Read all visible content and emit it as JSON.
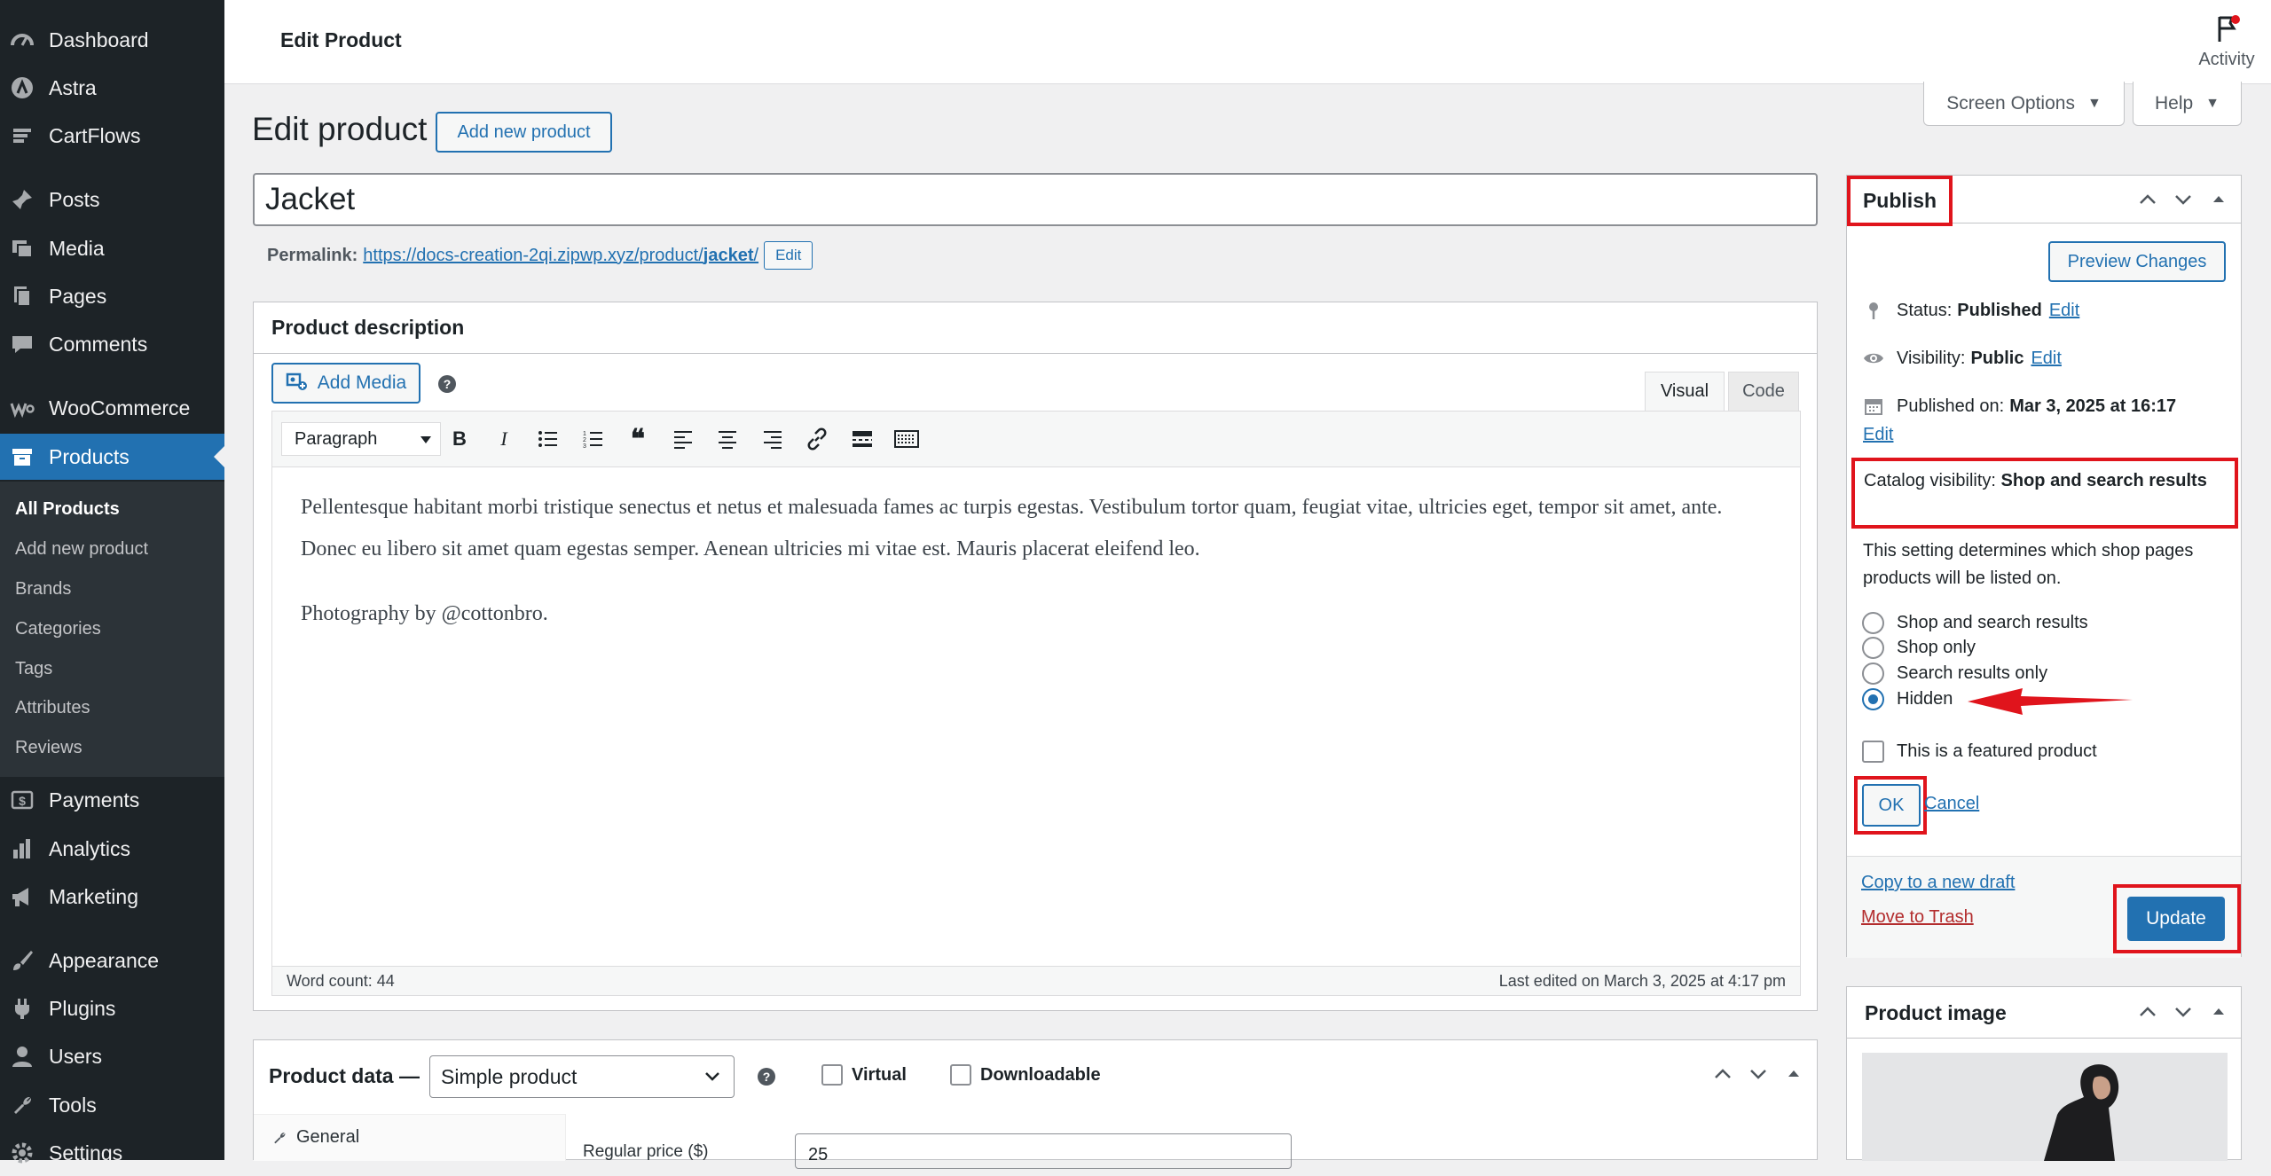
{
  "sidebar": {
    "menu": [
      {
        "label": "Dashboard",
        "icon": "dashboard-icon"
      },
      {
        "label": "Astra",
        "icon": "astra-icon"
      },
      {
        "label": "CartFlows",
        "icon": "cartflows-icon"
      },
      {
        "label": "Posts",
        "icon": "pin-icon"
      },
      {
        "label": "Media",
        "icon": "media-icon"
      },
      {
        "label": "Pages",
        "icon": "pages-icon"
      },
      {
        "label": "Comments",
        "icon": "comment-icon"
      },
      {
        "label": "WooCommerce",
        "icon": "woocommerce-icon"
      },
      {
        "label": "Products",
        "icon": "archive-icon"
      },
      {
        "label": "Payments",
        "icon": "payments-icon"
      },
      {
        "label": "Analytics",
        "icon": "analytics-icon"
      },
      {
        "label": "Marketing",
        "icon": "megaphone-icon"
      },
      {
        "label": "Appearance",
        "icon": "brush-icon"
      },
      {
        "label": "Plugins",
        "icon": "plug-icon"
      },
      {
        "label": "Users",
        "icon": "user-icon"
      },
      {
        "label": "Tools",
        "icon": "wrench-icon"
      },
      {
        "label": "Settings",
        "icon": "settings-icon"
      }
    ],
    "submenu": [
      "All Products",
      "Add new product",
      "Brands",
      "Categories",
      "Tags",
      "Attributes",
      "Reviews"
    ]
  },
  "topbar": {
    "title": "Edit Product",
    "activity_label": "Activity"
  },
  "screen_options_label": "Screen Options",
  "help_label": "Help",
  "heading": {
    "title": "Edit product",
    "add_new_label": "Add new product"
  },
  "product_title": "Jacket",
  "permalink": {
    "label": "Permalink:",
    "url_base": "https://docs-creation-2qi.zipwp.xyz/product/",
    "slug": "jacket",
    "url_end": "/",
    "edit_label": "Edit"
  },
  "description": {
    "header": "Product description",
    "add_media_label": "Add Media",
    "help_glyph": "?",
    "tab_visual": "Visual",
    "tab_code": "Code",
    "format": "Paragraph",
    "paragraphs": [
      "Pellentesque habitant morbi tristique senectus et netus et malesuada fames ac turpis egestas. Vestibulum tortor quam, feugiat vitae, ultricies eget, tempor sit amet, ante. Donec eu libero sit amet quam egestas semper. Aenean ultricies mi vitae est. Mauris placerat eleifend leo.",
      "Photography by @cottonbro."
    ],
    "word_count": "Word count: 44",
    "last_edited": "Last edited on March 3, 2025 at 4:17 pm"
  },
  "product_data": {
    "title": "Product data —",
    "type": "Simple product",
    "help_glyph": "?",
    "virtual_label": "Virtual",
    "downloadable_label": "Downloadable",
    "tab_general": "General",
    "regular_price_label": "Regular price ($)",
    "regular_price_value": "25"
  },
  "publish": {
    "title": "Publish",
    "preview_label": "Preview Changes",
    "status_label": "Status:",
    "status_value": "Published",
    "visibility_label": "Visibility:",
    "visibility_value": "Public",
    "published_label": "Published on:",
    "published_value": "Mar 3, 2025 at 16:17",
    "edit_label": "Edit",
    "catalog_label": "Catalog visibility:",
    "catalog_value": "Shop and search results",
    "catalog_desc": "This setting determines which shop pages products will be listed on.",
    "options": [
      {
        "label": "Shop and search results",
        "checked": false
      },
      {
        "label": "Shop only",
        "checked": false
      },
      {
        "label": "Search results only",
        "checked": false
      },
      {
        "label": "Hidden",
        "checked": true
      }
    ],
    "featured_label": "This is a featured product",
    "ok_label": "OK",
    "cancel_label": "Cancel",
    "copy_draft_label": "Copy to a new draft",
    "trash_label": "Move to Trash",
    "update_label": "Update"
  },
  "product_image": {
    "title": "Product image"
  },
  "colors": {
    "accent": "#2271b1",
    "highlight": "#e0141c",
    "sidebar": "#1d2327"
  }
}
